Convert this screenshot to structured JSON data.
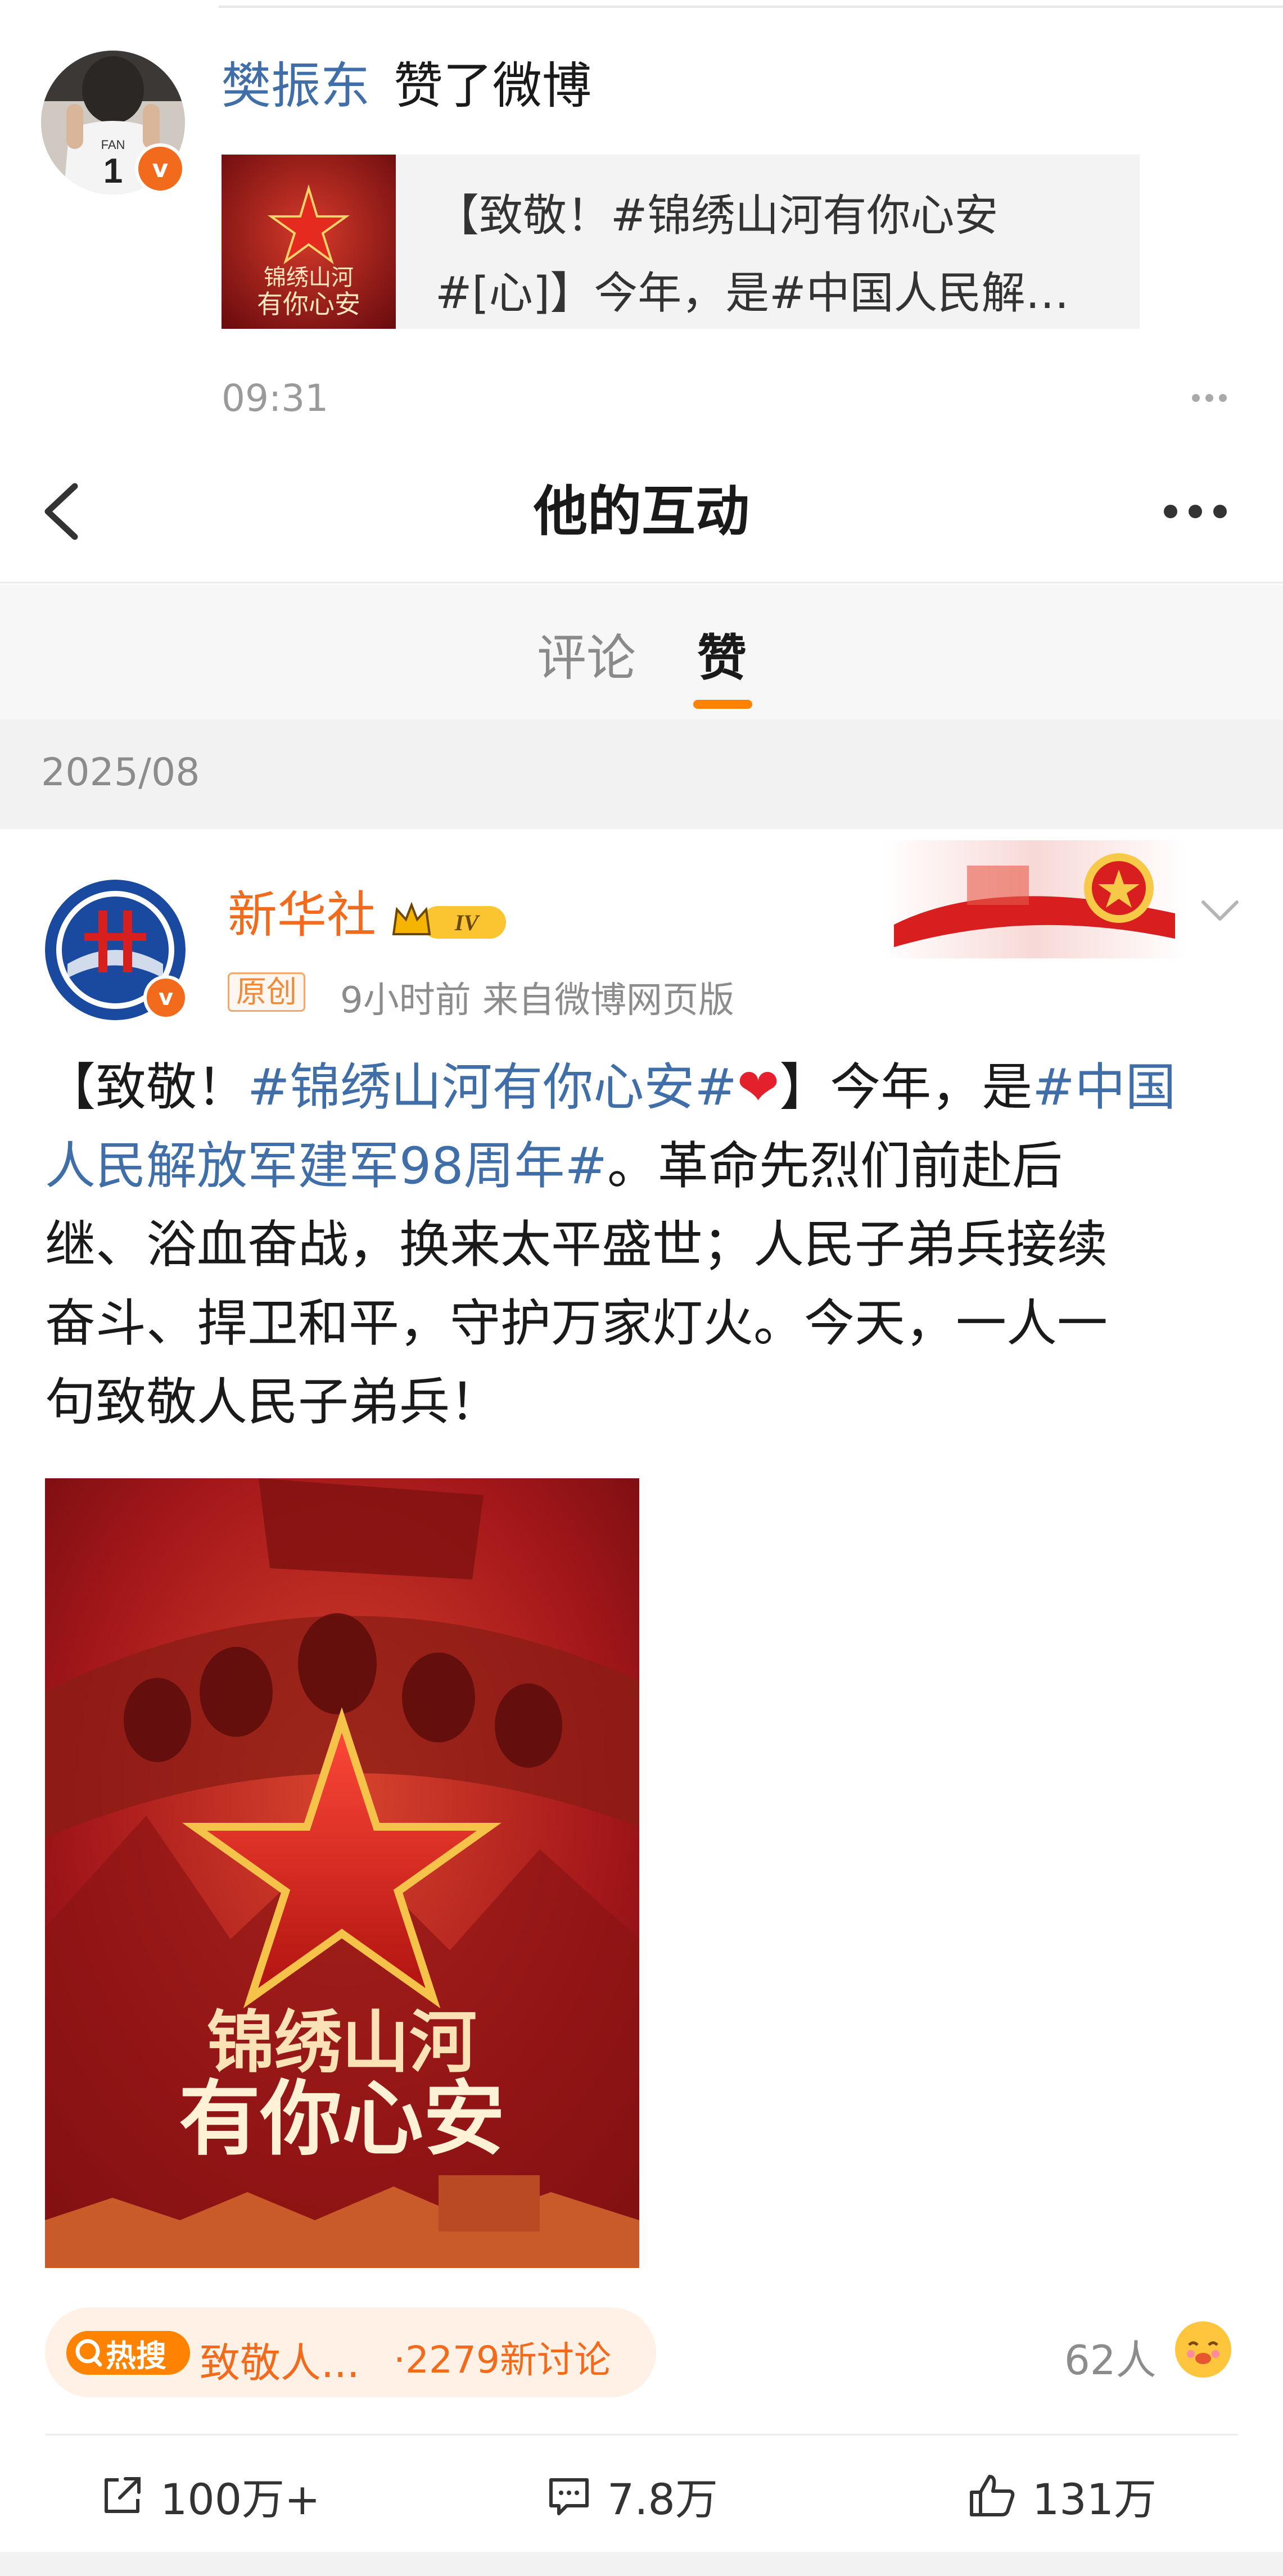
{
  "notification": {
    "user": "樊振东",
    "action": "赞了微博",
    "quote_line1": "【致敬！#锦绣山河有你心安",
    "quote_line2": "#[心]】今年，是#中国人民解…",
    "time": "09:31",
    "avatar_jersey_name": "FAN",
    "avatar_jersey_number": "1"
  },
  "nav": {
    "title": "他的互动"
  },
  "tabs": [
    {
      "label": "评论",
      "active": false
    },
    {
      "label": "赞",
      "active": true
    }
  ],
  "date_group": "2025/08",
  "post": {
    "author": "新华社",
    "level_badge": "IV",
    "original_tag": "原创",
    "meta": "9小时前  来自微博网页版",
    "body_lines": [
      [
        {
          "t": "【致敬！"
        },
        {
          "t": "#锦绣山河有你心安#",
          "tag": true
        },
        {
          "t": "❤",
          "heart": true
        },
        {
          "t": "】今年，是"
        },
        {
          "t": "#中国",
          "tag": true
        }
      ],
      [
        {
          "t": "人民解放军建军98周年#",
          "tag": true
        },
        {
          "t": "。革命先烈们前赴后"
        }
      ],
      [
        {
          "t": "继、浴血奋战，换来太平盛世；人民子弟兵接续"
        }
      ],
      [
        {
          "t": "奋斗、捍卫和平，守护万家灯火。今天，一人一"
        }
      ],
      [
        {
          "t": "句致敬人民子弟兵！"
        }
      ]
    ],
    "poster_line1": "锦绣山河",
    "poster_line2": "有你心安",
    "thumb_line1": "锦绣山河",
    "thumb_line2": "有你心安",
    "hot_badge": "热搜",
    "hot_topic": "致敬人...",
    "hot_count": "·2279新讨论",
    "people": "62人",
    "repost": "100万+",
    "comments": "7.8万",
    "likes": "131万"
  },
  "colors": {
    "accent_orange": "#ff8200",
    "link_blue": "#3f6ea8",
    "author_orange": "#f26b1d",
    "poster_red": "#b3161b"
  }
}
